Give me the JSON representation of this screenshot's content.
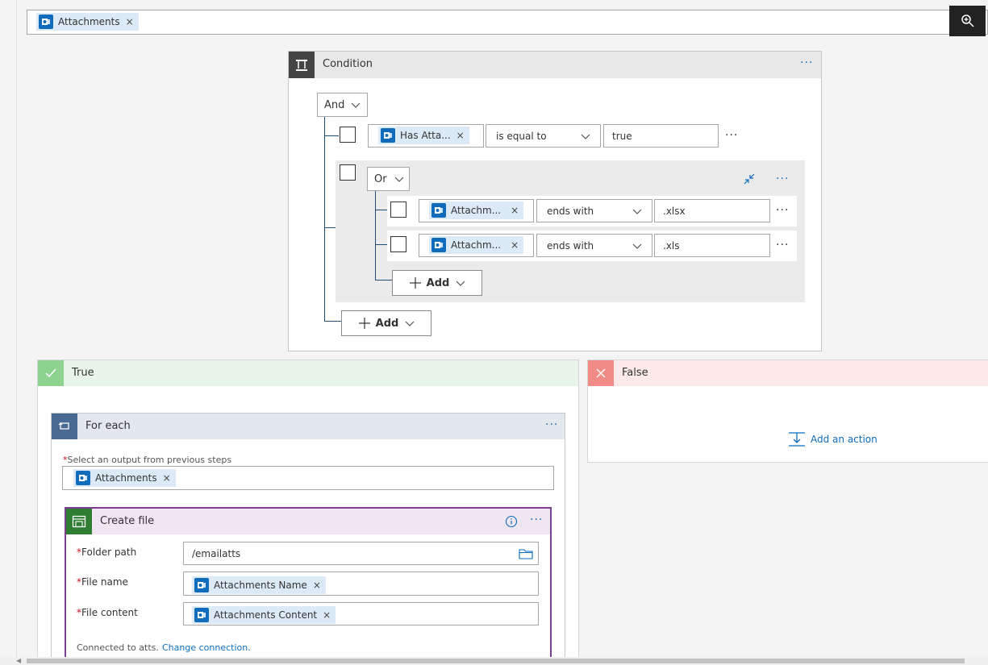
{
  "top": {
    "token": "Attachments"
  },
  "condition": {
    "title": "Condition",
    "and_label": "And",
    "row1": {
      "token": "Has Atta...",
      "operator": "is equal to",
      "value": "true"
    },
    "or_label": "Or",
    "row2": {
      "token": "Attachm...",
      "operator": "ends with",
      "value": ".xlsx"
    },
    "row3": {
      "token": "Attachm...",
      "operator": "ends with",
      "value": ".xls"
    },
    "add_inner": "Add",
    "add_outer": "Add"
  },
  "true_branch": {
    "title": "True"
  },
  "false_branch": {
    "title": "False",
    "add_action": "Add an action"
  },
  "foreach": {
    "title": "For each",
    "select_label": "Select an output from previous steps",
    "token": "Attachments"
  },
  "createfile": {
    "title": "Create file",
    "folder_label": "Folder path",
    "folder_value": "/emailatts",
    "name_label": "File name",
    "name_token": "Attachments Name",
    "content_label": "File content",
    "content_token": "Attachments Content",
    "connected_text": "Connected to atts.",
    "change_connection": "Change connection."
  },
  "colors": {
    "accent_blue": "#0f6cbd",
    "true_green": "#8dd38f",
    "false_red": "#f08b85",
    "purple_border": "#7a3f8f"
  }
}
